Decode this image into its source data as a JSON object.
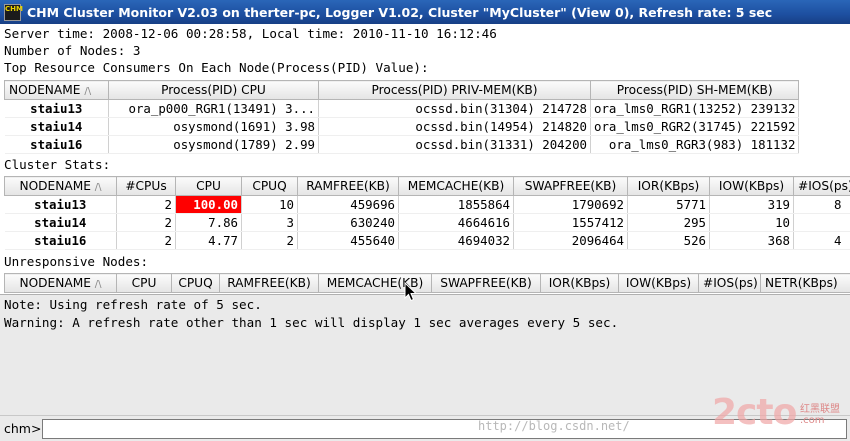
{
  "window": {
    "title": "CHM Cluster Monitor V2.03 on therter-pc, Logger V1.02, Cluster \"MyCluster\"  (View 0), Refresh rate: 5 sec",
    "icon_text": "CHM",
    "icon": "chm-app-icon"
  },
  "info": {
    "server_time_line": "Server time: 2008-12-06 00:28:58, Local time: 2010-11-10 16:12:46",
    "nodes_line": "Number of Nodes: 3",
    "consumers_heading": "Top Resource Consumers On Each Node(Process(PID) Value):"
  },
  "consumers": {
    "headers": [
      "NODENAME",
      "Process(PID) CPU",
      "Process(PID) PRIV-MEM(KB)",
      "Process(PID) SH-MEM(KB)"
    ],
    "sort_indicator": "/\\",
    "rows": [
      {
        "node": "staiu13",
        "cpu": "ora_p000_RGR1(13491) 3...",
        "priv": "ocssd.bin(31304) 214728",
        "sh": "ora_lms0_RGR1(13252) 239132"
      },
      {
        "node": "staiu14",
        "cpu": "osysmond(1691) 3.98",
        "priv": "ocssd.bin(14954) 214820",
        "sh": "ora_lms0_RGR2(31745) 221592"
      },
      {
        "node": "staiu16",
        "cpu": "osysmond(1789) 2.99",
        "priv": "ocssd.bin(31331) 204200",
        "sh": "ora_lms0_RGR3(983) 181132"
      }
    ]
  },
  "cluster_stats": {
    "heading": "Cluster Stats:",
    "headers": [
      "NODENAME",
      "#CPUs",
      "CPU",
      "CPUQ",
      "RAMFREE(KB)",
      "MEMCACHE(KB)",
      "SWAPFREE(KB)",
      "IOR(KBps)",
      "IOW(KBps)",
      "#IOS(ps)"
    ],
    "rows": [
      {
        "node": "staiu13",
        "cpus": "2",
        "cpu": "100.00",
        "cpuq": "10",
        "ramfree": "459696",
        "memcache": "1855864",
        "swapfree": "1790692",
        "ior": "5771",
        "iow": "319",
        "ios": "8"
      },
      {
        "node": "staiu14",
        "cpus": "2",
        "cpu": "7.86",
        "cpuq": "3",
        "ramfree": "630240",
        "memcache": "4664616",
        "swapfree": "1557412",
        "ior": "295",
        "iow": "10",
        "ios": ""
      },
      {
        "node": "staiu16",
        "cpus": "2",
        "cpu": "4.77",
        "cpuq": "2",
        "ramfree": "455640",
        "memcache": "4694032",
        "swapfree": "2096464",
        "ior": "526",
        "iow": "368",
        "ios": "4"
      }
    ],
    "alert_color": "#ff0000"
  },
  "unresponsive": {
    "heading": "Unresponsive Nodes:",
    "headers": [
      "NODENAME",
      "CPU",
      "CPUQ",
      "RAMFREE(KB)",
      "MEMCACHE(KB)",
      "SWAPFREE(KB)",
      "IOR(KBps)",
      "IOW(KBps)",
      "#IOS(ps)",
      "NETR(KBps)"
    ]
  },
  "messages": {
    "note": "Note: Using refresh rate of 5 sec.",
    "warning": "Warning: A refresh rate other than 1 sec will display 1 sec averages every 5 sec."
  },
  "command": {
    "label": "chm>",
    "value": ""
  },
  "watermark": {
    "url": "http://blog.csdn.net/",
    "brand": "2cto",
    "brand_sub": "红黑联盟",
    "brand_sub2": ".com"
  },
  "colors": {
    "titlebar": "#1d4fa0",
    "alert": "#ff0000",
    "message_bg": "#eaeaea"
  }
}
